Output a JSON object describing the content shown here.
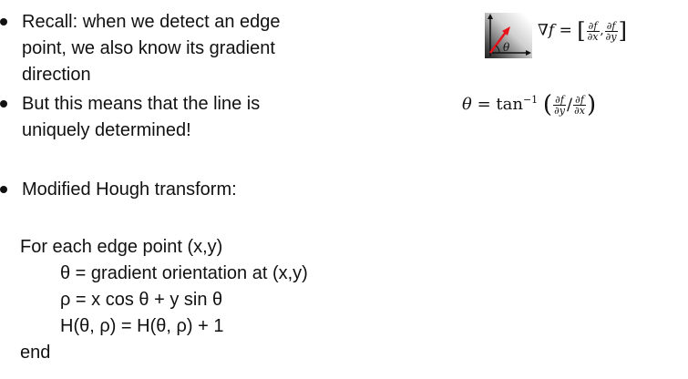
{
  "bullets": [
    {
      "text": "Recall: when we detect an edge point, we also know its gradient direction"
    },
    {
      "text": "But this means that the line is uniquely determined!"
    },
    {
      "text": "Modified Hough transform:"
    }
  ],
  "pseudocode": {
    "header": "For each edge point (x,y)",
    "lines": [
      "θ = gradient orientation at (x,y)",
      "ρ = x cos θ + y sin θ",
      "H(θ, ρ) = H(θ, ρ) + 1"
    ],
    "end": "end"
  },
  "diagram": {
    "angle_label": "θ",
    "arrow_color": "#e8141b",
    "axis_color": "#111111"
  },
  "formula_gradient": {
    "lhs": "∇f",
    "equals": "=",
    "partial_f": "∂f",
    "partial_x": "∂x",
    "partial_y": "∂y",
    "separator": ","
  },
  "formula_theta": {
    "theta": "θ",
    "equals": "=",
    "func": "tan",
    "exponent": "−1",
    "partial_f": "∂f",
    "partial_x": "∂x",
    "partial_y": "∂y",
    "slash": "/"
  }
}
